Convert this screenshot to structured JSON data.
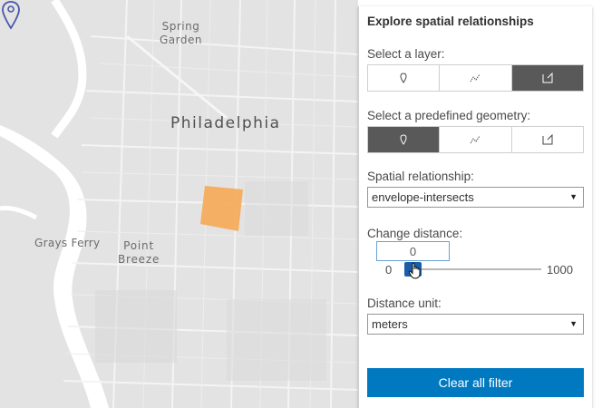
{
  "map": {
    "labels": {
      "spring_garden": "Spring\nGarden",
      "philadelphia": "Philadelphia",
      "grays_ferry": "Grays Ferry",
      "point_breeze": "Point\nBreeze"
    },
    "colors": {
      "land": "#e3e3e3",
      "water": "#ffffff",
      "roads": "#f5f5f5",
      "blocks": "#d6d6d6",
      "query_geometry": "#f6a955",
      "pin_stroke": "#4a56a8"
    }
  },
  "panel": {
    "title": "Explore spatial relationships",
    "layer_label": "Select a layer:",
    "layer_buttons": [
      {
        "icon": "point-icon",
        "active": false
      },
      {
        "icon": "polyline-icon",
        "active": false
      },
      {
        "icon": "polygon-icon",
        "active": true
      }
    ],
    "geometry_label": "Select a predefined geometry:",
    "geometry_buttons": [
      {
        "icon": "point-icon",
        "active": true
      },
      {
        "icon": "polyline-icon",
        "active": false
      },
      {
        "icon": "polygon-icon",
        "active": false
      }
    ],
    "relationship_label": "Spatial relationship:",
    "relationship_value": "envelope-intersects",
    "distance_label": "Change distance:",
    "distance_value": "0",
    "slider_min": "0",
    "slider_max": "1000",
    "unit_label": "Distance unit:",
    "unit_value": "meters",
    "clear_button": "Clear all filter",
    "accent_color": "#0079c1"
  }
}
